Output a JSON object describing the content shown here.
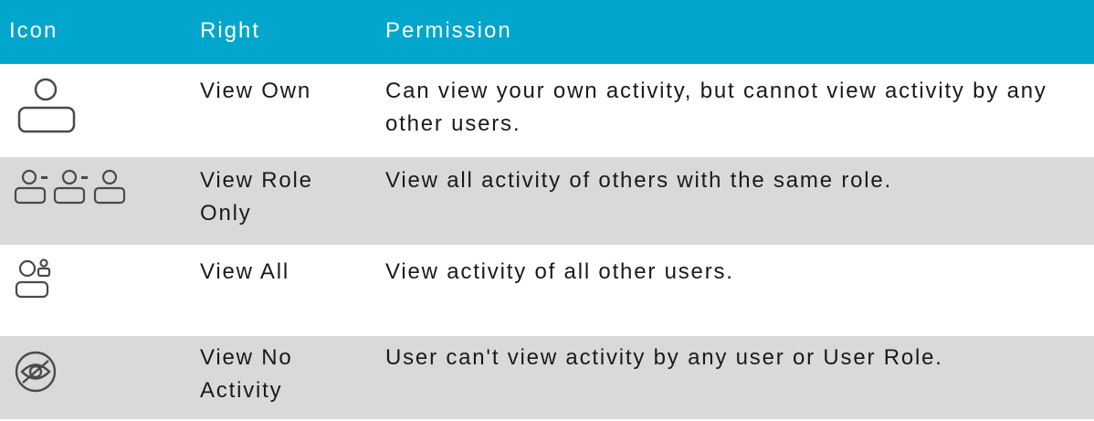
{
  "header": {
    "icon": "Icon",
    "right": "Right",
    "permission": "Permission"
  },
  "rows": [
    {
      "icon": "single-user-icon",
      "right": "View Own",
      "permission": "Can view your own activity, but cannot view activity by any other users."
    },
    {
      "icon": "user-group-chain-icon",
      "right": "View Role Only",
      "permission": "View all activity of others with the same role."
    },
    {
      "icon": "users-all-icon",
      "right": "View All",
      "permission": "View activity of all other users."
    },
    {
      "icon": "eye-slash-icon",
      "right": "View No Activity",
      "permission": "User can't view activity by any user or User Role."
    }
  ],
  "colors": {
    "header_bg": "#00a6cc",
    "alt_row_bg": "#d9d9d9",
    "text": "#1a1a1a"
  }
}
